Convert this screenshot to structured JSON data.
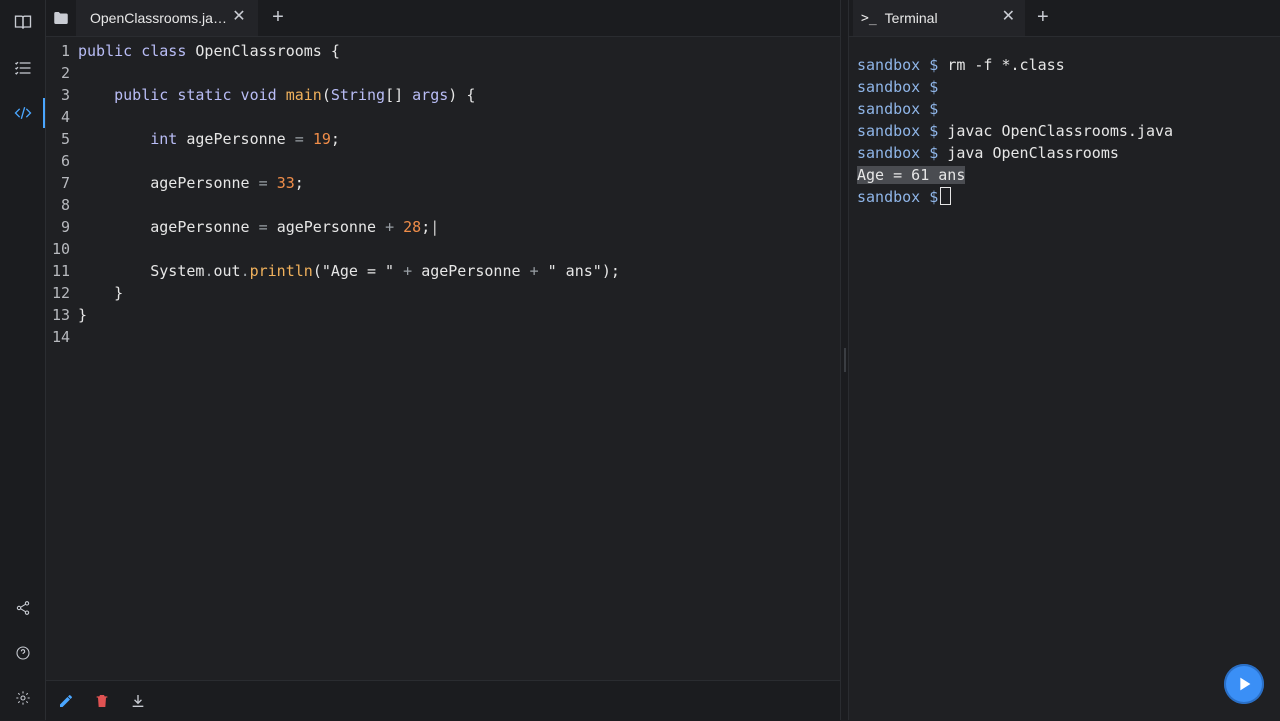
{
  "activity_bar": {
    "items": [
      {
        "name": "book-icon"
      },
      {
        "name": "list-icon"
      },
      {
        "name": "code-icon",
        "active": true
      },
      {
        "name": "share-icon"
      },
      {
        "name": "help-icon"
      },
      {
        "name": "gear-icon"
      }
    ]
  },
  "editor": {
    "tab_label": "OpenClassrooms.ja…",
    "lines": [
      {
        "n": "1"
      },
      {
        "n": "2"
      },
      {
        "n": "3"
      },
      {
        "n": "4"
      },
      {
        "n": "5"
      },
      {
        "n": "6"
      },
      {
        "n": "7"
      },
      {
        "n": "8"
      },
      {
        "n": "9"
      },
      {
        "n": "10"
      },
      {
        "n": "11"
      },
      {
        "n": "12"
      },
      {
        "n": "13"
      },
      {
        "n": "14"
      }
    ],
    "code": {
      "l1_kw": "public class",
      "l1_name": "OpenClassrooms",
      "l1_brace": "{",
      "l3_kw": "public static void",
      "l3_fn": "main",
      "l3_type": "String",
      "l3_args": "args",
      "l3_tail": ") {",
      "l5_kw": "int",
      "l5_var": "agePersonne",
      "l5_num": "19",
      "l7_var": "agePersonne",
      "l7_num": "33",
      "l9_var": "agePersonne",
      "l9_var2": "agePersonne",
      "l9_num": "28",
      "l11_obj": "System",
      "l11_out": "out",
      "l11_fn": "println",
      "l11_str1": "\"Age = \"",
      "l11_var": "agePersonne",
      "l11_str2": "\" ans\"",
      "l12_brace": "}",
      "l13_brace": "}"
    }
  },
  "terminal": {
    "tab_label": "Terminal",
    "tab_icon": ">_",
    "prompt": "sandbox $",
    "lines": [
      {
        "prompt": "sandbox $",
        "cmd": "rm -f *.class"
      },
      {
        "prompt": "sandbox $",
        "cmd": ""
      },
      {
        "prompt": "sandbox $",
        "cmd": ""
      },
      {
        "prompt": "sandbox $",
        "cmd": "javac OpenClassrooms.java"
      },
      {
        "prompt": "sandbox $",
        "cmd": "java OpenClassrooms"
      }
    ],
    "output": "Age = 61 ans",
    "last_prompt": "sandbox $"
  },
  "footer": {
    "icons": [
      "pencil-icon",
      "trash-icon",
      "download-icon"
    ]
  },
  "colors": {
    "accent": "#3a8ff6",
    "prompt": "#8fb5e8",
    "number": "#f08d49",
    "function": "#f0b15c",
    "keyword": "#b9bdf6",
    "delete": "#e05252"
  }
}
